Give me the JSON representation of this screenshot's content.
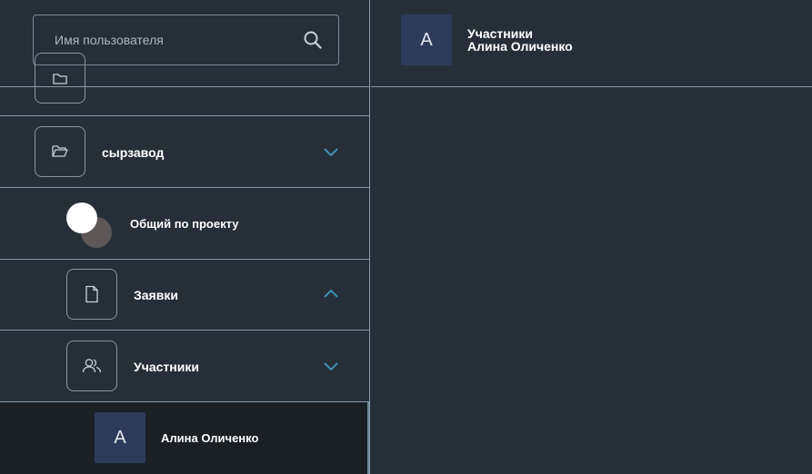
{
  "search": {
    "placeholder": "Имя пользователя"
  },
  "tree": {
    "project": {
      "label": "сырзавод",
      "icon": "folder-open-icon",
      "expanded": true
    },
    "overall": {
      "label": "Общий по проекту",
      "toggle_on": true
    },
    "requests": {
      "label": "Заявки",
      "icon": "document-icon",
      "expanded": true
    },
    "members": {
      "label": "Участники",
      "icon": "users-icon",
      "expanded": false
    },
    "member_user": {
      "avatar_letter": "А",
      "name": "Алина Оличенко",
      "selected": true
    }
  },
  "header": {
    "avatar_letter": "А",
    "title": "Участники",
    "subtitle": "Алина Оличенко"
  },
  "colors": {
    "background": "#262f38",
    "divider": "#8a98a3",
    "accent_chevron": "#3f8fb5",
    "avatar_bg": "#2d3a5a",
    "selected_bg": "#1b2025"
  }
}
